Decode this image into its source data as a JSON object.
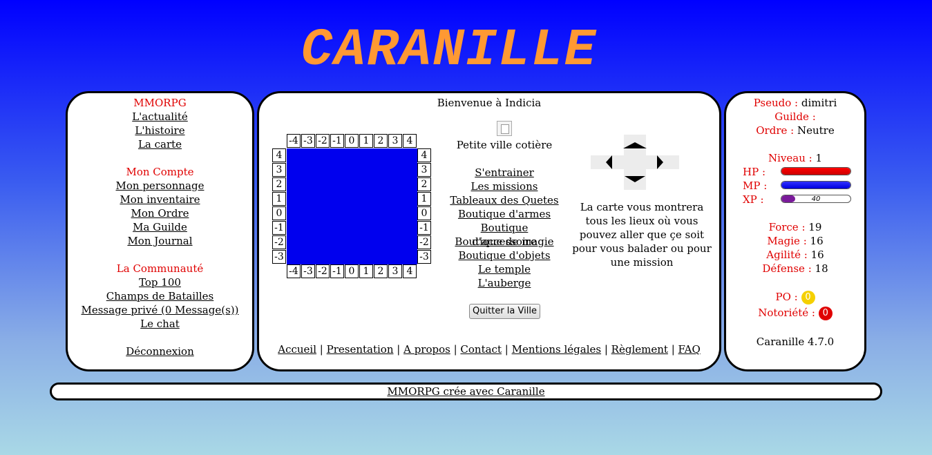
{
  "logo": "CARANILLE",
  "left_menu": {
    "section1_title": "MMORPG",
    "section1_links": [
      "L'actualité",
      "L'histoire",
      "La carte"
    ],
    "section2_title": "Mon Compte",
    "section2_links": [
      "Mon personnage",
      "Mon inventaire",
      "Mon Ordre",
      "Ma Guilde",
      "Mon Journal"
    ],
    "section3_title": "La Communauté",
    "section3_links": [
      "Top 100",
      "Champs de Batailles",
      "Message privé (0 Message(s))",
      "Le chat"
    ],
    "logout": "Déconnexion"
  },
  "center": {
    "welcome": "Bienvenue à Indicia",
    "grid_cols": [
      "-4",
      "-3",
      "-2",
      "-1",
      "0",
      "1",
      "2",
      "3",
      "4"
    ],
    "grid_rows": [
      "4",
      "3",
      "2",
      "1",
      "0",
      "-1",
      "-2",
      "-3"
    ],
    "city_name": "Petite ville cotière",
    "city_links": [
      "S'entrainer",
      "Les missions",
      "Tableaux des Quetes",
      "Boutique d'armes",
      "Boutique d'accessoire",
      "Boutique de magie",
      "Boutique d'objets",
      "Le temple",
      "L'auberge"
    ],
    "quit_button": "Quitter la Ville",
    "map_info": "La carte vous montrera tous les lieux où vous pouvez aller que çe soit pour vous balader ou pour une mission",
    "footer_links": [
      "Accueil",
      "Presentation",
      "A propos",
      "Contact",
      "Mentions légales",
      "Règlement",
      "FAQ"
    ],
    "map_color": "#0000ee"
  },
  "right": {
    "pseudo_label": "Pseudo :",
    "pseudo": "dimitri",
    "guild_label": "Guilde :",
    "guild": "",
    "order_label": "Ordre :",
    "order": "Neutre",
    "level_label": "Niveau :",
    "level": "1",
    "hp_label": "HP :",
    "mp_label": "MP :",
    "xp_label": "XP :",
    "hp_fraction": 1.0,
    "mp_fraction": 1.0,
    "xp_fraction": 0.2,
    "xp_value": "40",
    "force_label": "Force :",
    "force": "19",
    "magie_label": "Magie :",
    "magie": "16",
    "agilite_label": "Agilité :",
    "agilite": "16",
    "defense_label": "Défense :",
    "defense": "18",
    "po_label": "PO :",
    "po": "0",
    "notoriete_label": "Notoriété :",
    "notoriete": "0",
    "version": "Caranille 4.7.0",
    "colors": {
      "hp": "#ff0000",
      "mp": "#0000dd",
      "xp": "#7a1a9a",
      "po": "#f5d000",
      "notoriete": "#e00000"
    }
  },
  "footer": {
    "text": "MMORPG crée avec Caranille"
  }
}
